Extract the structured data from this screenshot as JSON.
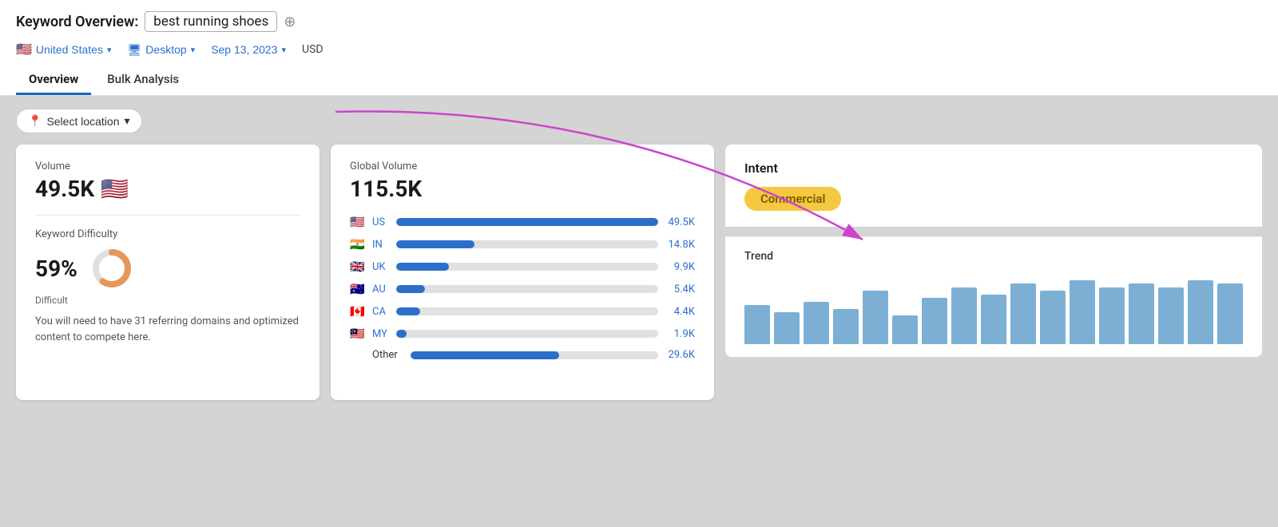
{
  "header": {
    "title_label": "Keyword Overview:",
    "keyword": "best running shoes",
    "add_icon": "⊕",
    "filters": {
      "location": "United States",
      "location_flag": "🇺🇸",
      "device": "Desktop",
      "device_icon": "🖥",
      "date": "Sep 13, 2023",
      "currency": "USD"
    },
    "tabs": [
      {
        "label": "Overview",
        "active": true
      },
      {
        "label": "Bulk Analysis",
        "active": false
      }
    ]
  },
  "location_btn": {
    "label": "Select location",
    "icon": "📍"
  },
  "volume_card": {
    "label": "Volume",
    "value": "49.5K",
    "flag": "🇺🇸",
    "difficulty_label": "Keyword Difficulty",
    "difficulty_value": "59%",
    "difficulty_word": "Difficult",
    "difficulty_desc": "You will need to have 31 referring domains and optimized content to compete here.",
    "donut_pct": 59
  },
  "global_card": {
    "label": "Global Volume",
    "value": "115.5K",
    "rows": [
      {
        "flag": "🇺🇸",
        "code": "US",
        "pct": 100,
        "value": "49.5K"
      },
      {
        "flag": "🇮🇳",
        "code": "IN",
        "pct": 30,
        "value": "14.8K"
      },
      {
        "flag": "🇬🇧",
        "code": "UK",
        "pct": 20,
        "value": "9.9K"
      },
      {
        "flag": "🇦🇺",
        "code": "AU",
        "pct": 11,
        "value": "5.4K"
      },
      {
        "flag": "🇨🇦",
        "code": "CA",
        "pct": 9,
        "value": "4.4K"
      },
      {
        "flag": "🇲🇾",
        "code": "MY",
        "pct": 4,
        "value": "1.9K"
      }
    ],
    "other_label": "Other",
    "other_pct": 60,
    "other_value": "29.6K"
  },
  "intent_card": {
    "label": "Intent",
    "badge": "Commercial"
  },
  "trend_card": {
    "label": "Trend",
    "bars": [
      55,
      45,
      60,
      50,
      75,
      40,
      65,
      80,
      70,
      85,
      75,
      90,
      80,
      85,
      80,
      90,
      85
    ]
  }
}
